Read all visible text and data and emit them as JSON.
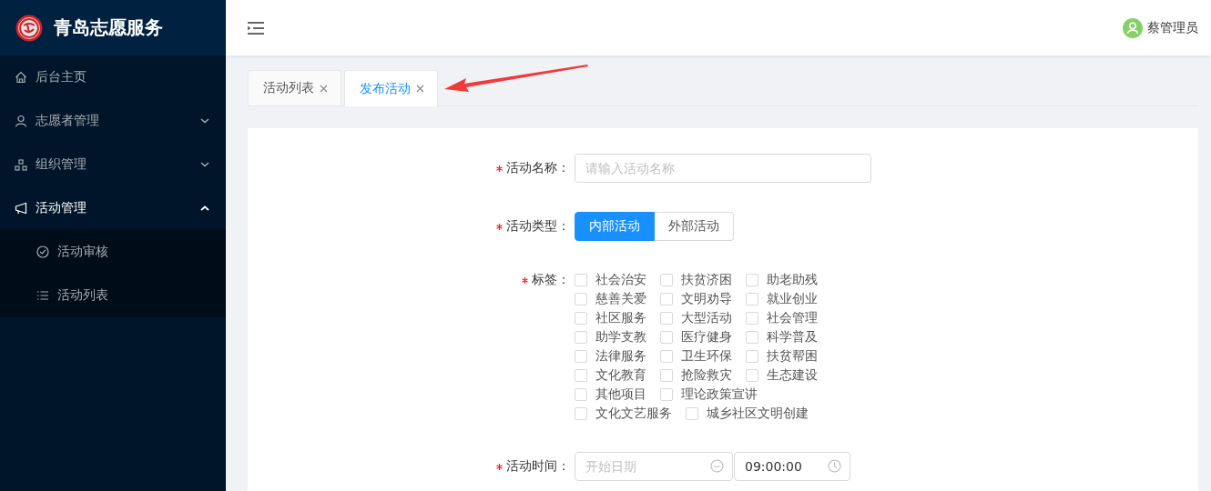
{
  "sidebar": {
    "title": "青岛志愿服务",
    "menu": [
      {
        "label": "后台主页",
        "kind": "link"
      },
      {
        "label": "志愿者管理",
        "kind": "submenu",
        "expanded": false
      },
      {
        "label": "组织管理",
        "kind": "submenu",
        "expanded": false
      },
      {
        "label": "活动管理",
        "kind": "submenu",
        "expanded": true,
        "children": [
          {
            "label": "活动审核",
            "selected": false
          },
          {
            "label": "活动列表",
            "selected": false
          }
        ]
      }
    ]
  },
  "header": {
    "user": "蔡管理员"
  },
  "tabs": [
    {
      "label": "活动列表",
      "selected": false
    },
    {
      "label": "发布活动",
      "selected": true
    }
  ],
  "form": {
    "fields": [
      {
        "kind": "input",
        "label": "活动名称：",
        "required": true,
        "placeholder": "请输入活动名称"
      },
      {
        "kind": "radio-buttons",
        "label": "活动类型：",
        "required": true,
        "options": [
          {
            "label": "内部活动",
            "selected": true
          },
          {
            "label": "外部活动",
            "selected": false
          }
        ]
      },
      {
        "kind": "checkbox-group",
        "label": "标签：",
        "required": true,
        "options": [
          {
            "label": "社会治安",
            "checked": false
          },
          {
            "label": "扶贫济困",
            "checked": false
          },
          {
            "label": "助老助残",
            "checked": false
          },
          {
            "label": "慈善关爱",
            "checked": false
          },
          {
            "label": "文明劝导",
            "checked": false
          },
          {
            "label": "就业创业",
            "checked": false
          },
          {
            "label": "社区服务",
            "checked": false
          },
          {
            "label": "大型活动",
            "checked": false
          },
          {
            "label": "社会管理",
            "checked": false
          },
          {
            "label": "助学支教",
            "checked": false
          },
          {
            "label": "医疗健身",
            "checked": false
          },
          {
            "label": "科学普及",
            "checked": false
          },
          {
            "label": "法律服务",
            "checked": false
          },
          {
            "label": "卫生环保",
            "checked": false
          },
          {
            "label": "扶贫帮困",
            "checked": false
          },
          {
            "label": "文化教育",
            "checked": false
          },
          {
            "label": "抢险救灾",
            "checked": false
          },
          {
            "label": "生态建设",
            "checked": false
          },
          {
            "label": "其他项目",
            "checked": false
          },
          {
            "label": "理论政策宣讲",
            "checked": false
          },
          {
            "label": "文化文艺服务",
            "checked": false
          },
          {
            "label": "城乡社区文明创建",
            "checked": false
          }
        ]
      },
      {
        "kind": "date-time",
        "label": "活动时间：",
        "required": true,
        "date_placeholder": "开始日期",
        "time_value": "09:00:00"
      }
    ]
  }
}
